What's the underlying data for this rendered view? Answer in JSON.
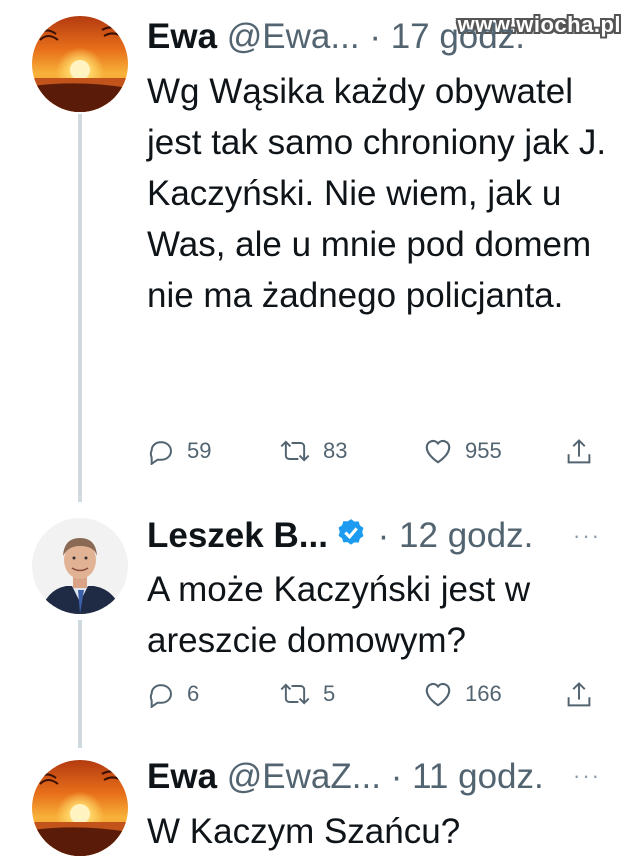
{
  "watermark": "www.wiocha.pl",
  "colors": {
    "verified": "#1d9bf0",
    "muted": "#536471",
    "thread_line": "#cfd9de"
  },
  "tweets": [
    {
      "avatar_icon": "sunset-avatar-icon",
      "name": "Ewa",
      "handle": "@Ewa...",
      "time": "· 17 godz.",
      "more_icon": "more-icon",
      "text": "Wg Wąsika każdy obywatel jest tak samo chroniony jak J. Kaczyński. Nie wiem, jak u Was, ale u mnie pod domem nie ma żadnego policjanta.",
      "replies": "59",
      "retweets": "83",
      "likes": "955"
    },
    {
      "avatar_icon": "portrait-avatar-icon",
      "name": "Leszek B...",
      "handle": "",
      "verified_icon": "verified-badge-icon",
      "time": "· 12 godz.",
      "more": "···",
      "text": "A może Kaczyński jest w areszcie domowym?",
      "replies": "6",
      "retweets": "5",
      "likes": "166"
    },
    {
      "avatar_icon": "sunset-avatar-icon",
      "name": "Ewa",
      "handle": "@EwaZ...",
      "time": "· 11 godz.",
      "more": "···",
      "text": "W Kaczym Szańcu?"
    }
  ]
}
